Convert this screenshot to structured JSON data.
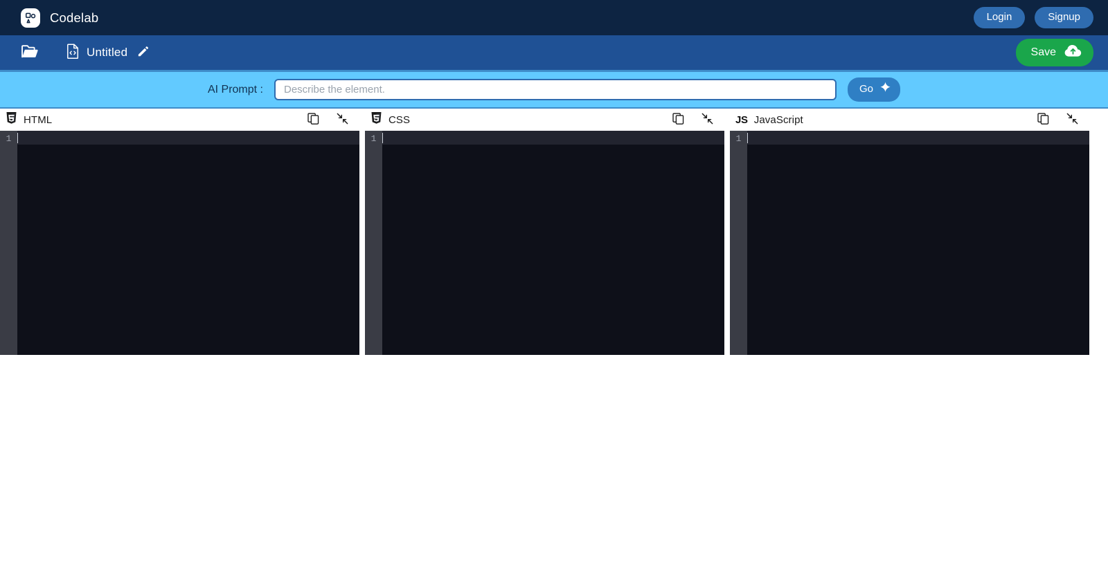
{
  "navbar": {
    "brand_name": "Codelab",
    "logo_icon": "shapes-logo-icon",
    "login_label": "Login",
    "signup_label": "Signup"
  },
  "filebar": {
    "folder_icon": "open-folder-icon",
    "file_icon": "code-file-icon",
    "file_name": "Untitled",
    "edit_icon": "pencil-icon",
    "save_label": "Save",
    "save_icon": "cloud-upload-icon"
  },
  "prompt": {
    "label": "AI Prompt :",
    "placeholder": "Describe the element.",
    "value": "",
    "go_label": "Go",
    "go_icon": "sparkle-icon"
  },
  "editors": [
    {
      "id": "html",
      "title": "HTML",
      "logo_icon": "html5-logo-icon",
      "copy_icon": "copy-icon",
      "collapse_icon": "collapse-icon",
      "line_number": "1",
      "content": ""
    },
    {
      "id": "css",
      "title": "CSS",
      "logo_icon": "css3-logo-icon",
      "copy_icon": "copy-icon",
      "collapse_icon": "collapse-icon",
      "line_number": "1",
      "content": ""
    },
    {
      "id": "javascript",
      "title": "JavaScript",
      "logo_icon": "js-logo-icon",
      "logo_text": "JS",
      "copy_icon": "copy-icon",
      "collapse_icon": "collapse-icon",
      "line_number": "1",
      "content": ""
    }
  ],
  "colors": {
    "navbar_bg": "#0d2442",
    "filebar_bg": "#1f5195",
    "prompt_bg": "#62caff",
    "accent_blue": "#2f6cb0",
    "save_green": "#1aa64b",
    "editor_bg": "#0e1019",
    "gutter_bg": "#3a3c45"
  }
}
